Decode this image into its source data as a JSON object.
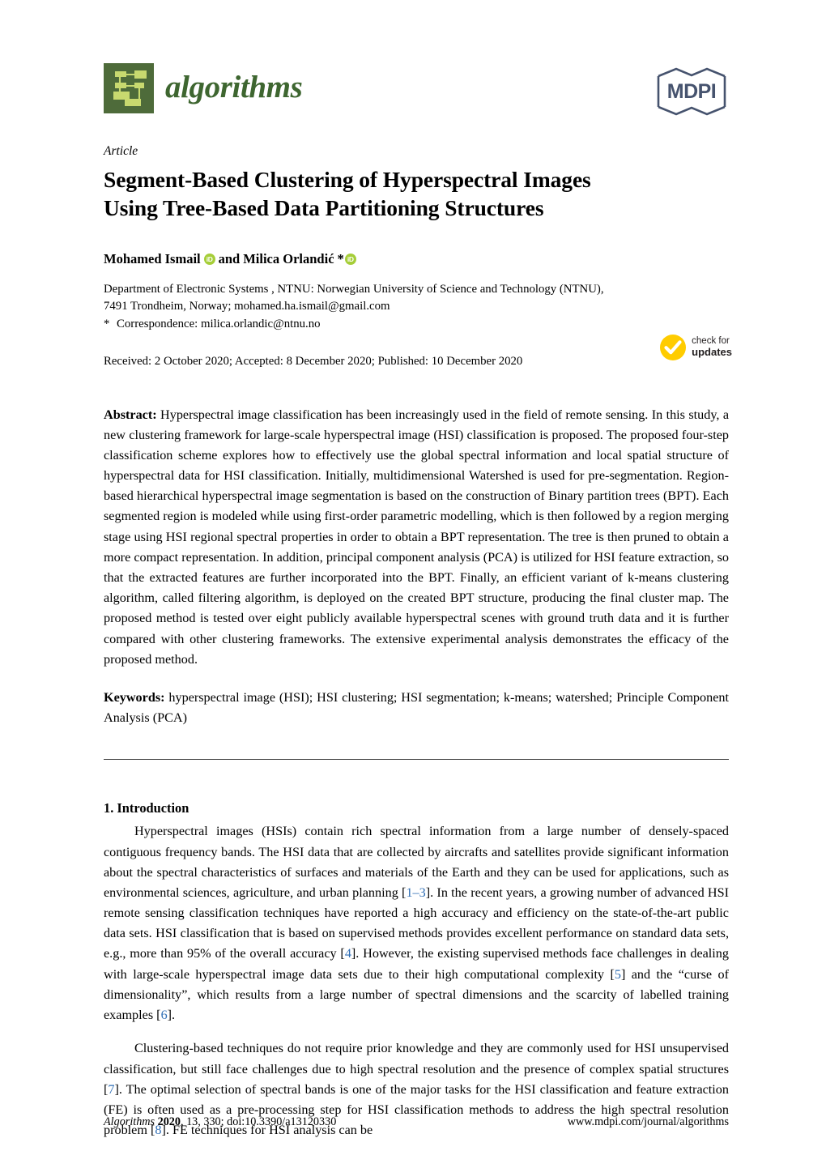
{
  "masthead": {
    "journal_name": "algorithms",
    "journal_logo_icon": "tree-diagram-icon",
    "publisher_logo_text": "MDPI",
    "publisher_logo_icon": "mdpi-hexagon-logo"
  },
  "article": {
    "type_label": "Article",
    "title": "Segment-Based Clustering of Hyperspectral Images Using Tree-Based Data Partitioning Structures",
    "title_line_1": "Segment-Based Clustering of Hyperspectral Images",
    "title_line_2": "Using Tree-Based Data Partitioning Structures"
  },
  "authors": {
    "author_1": "Mohamed Ismail",
    "conjunction": "and",
    "author_2": "Milica Orlandić",
    "corresponding_marker": "*",
    "orcid_label": "iD"
  },
  "affiliations": {
    "line_1": "Department of Electronic Systems , NTNU: Norwegian University of Science and Technology (NTNU),",
    "line_2": "7491 Trondheim, Norway; mohamed.ha.ismail@gmail.com",
    "correspondence_star": "*",
    "correspondence": "Correspondence: milica.orlandic@ntnu.no"
  },
  "dates": {
    "line": "Received: 2 October 2020; Accepted: 8 December 2020; Published: 10 December 2020"
  },
  "check_updates": {
    "line_1": "check for",
    "line_2": "updates",
    "icon": "check-mark-icon",
    "color": "#FFCC00"
  },
  "abstract": {
    "label": "Abstract:",
    "text": "Hyperspectral image classification has been increasingly used in the field of remote sensing. In this study, a new clustering framework for large-scale hyperspectral image (HSI) classification is proposed. The proposed four-step classification scheme explores how to effectively use the global spectral information and local spatial structure of hyperspectral data for HSI classification. Initially, multidimensional Watershed is used for pre-segmentation. Region-based hierarchical hyperspectral image segmentation is based on the construction of Binary partition trees (BPT). Each segmented region is modeled while using first-order parametric modelling, which is then followed by a region merging stage using HSI regional spectral properties in order to obtain a BPT representation. The tree is then pruned to obtain a more compact representation. In addition, principal component analysis (PCA) is utilized for HSI feature extraction, so that the extracted features are further incorporated into the BPT. Finally, an efficient variant of k-means clustering algorithm, called filtering algorithm, is deployed on the created BPT structure, producing the final cluster map. The proposed method is tested over eight publicly available hyperspectral scenes with ground truth data and it is further compared with other clustering frameworks. The extensive experimental analysis demonstrates the efficacy of the proposed method."
  },
  "keywords": {
    "label": "Keywords:",
    "text": "hyperspectral image (HSI); HSI clustering; HSI segmentation; k-means; watershed; Principle Component Analysis (PCA)"
  },
  "introduction": {
    "heading": "1. Introduction",
    "paragraph_1_a": "Hyperspectral images (HSIs) contain rich spectral information from a large number of densely-spaced contiguous frequency bands. The HSI data that are collected by aircrafts and satellites provide significant information about the spectral characteristics of surfaces and materials of the Earth and they can be used for applications, such as environmental sciences, agriculture, and urban planning [",
    "cite_1": "1",
    "dash_1": "–",
    "cite_2": "3",
    "paragraph_1_b": "]. In the recent years, a growing number of advanced HSI remote sensing classification techniques have reported a high accuracy and efficiency on the state-of-the-art public data sets. HSI classification that is based on supervised methods provides excellent performance on standard data sets, e.g., more than 95% of the overall accuracy [",
    "cite_3": "4",
    "paragraph_1_c": "]. However, the existing supervised methods face challenges in dealing with large-scale hyperspectral image data sets due to their high computational complexity [",
    "cite_4": "5",
    "paragraph_1_d": "] and the “curse of dimensionality”, which results from a large number of spectral dimensions and the scarcity of labelled training examples [",
    "cite_5": "6",
    "paragraph_1_e": "].",
    "paragraph_2_a": "Clustering-based techniques do not require prior knowledge and they are commonly used for HSI unsupervised classification, but still face challenges due to high spectral resolution and the presence of complex spatial structures [",
    "cite_6": "7",
    "paragraph_2_b": "]. The optimal selection of spectral bands is one of the major tasks for the HSI classification and feature extraction (FE) is often used as a pre-processing step for HSI classification methods to address the high spectral resolution problem [",
    "cite_7": "8",
    "paragraph_2_c": "]. FE techniques for HSI analysis can be"
  },
  "footer": {
    "journal_italic": "Algorithms",
    "year": "2020",
    "volume_issue": ", 13, 330; doi:10.3390/a13120330",
    "url": "www.mdpi.com/journal/algorithms"
  },
  "colors": {
    "journal_green": "#3e6630",
    "logo_bg_green": "#4e6b3a",
    "logo_block_green": "#c8d96f",
    "mdpi_navy": "#46536e",
    "orcid_green": "#a6ce39",
    "check_yellow": "#FFCC00",
    "citation_blue": "#2f6eb5"
  }
}
